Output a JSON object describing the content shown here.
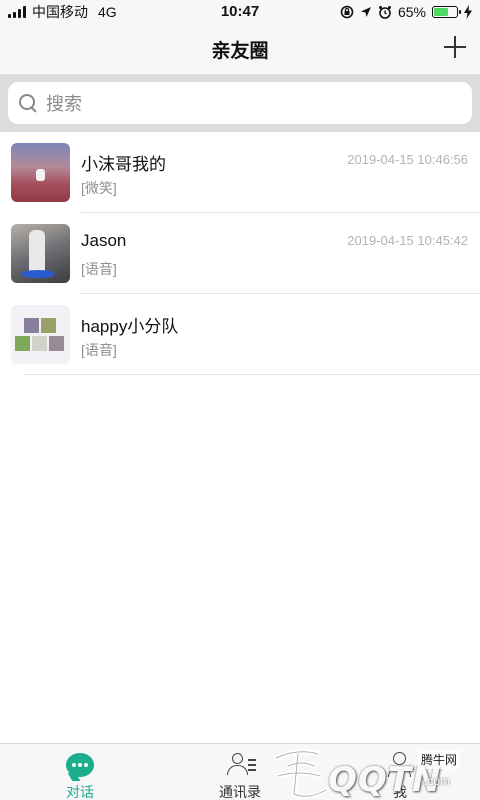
{
  "status_bar": {
    "carrier": "中国移动",
    "network": "4G",
    "time": "10:47",
    "battery_percent": "65%",
    "battery_level": 0.65,
    "icons": [
      "signal-icon",
      "lock-rotation-icon",
      "location-icon",
      "alarm-icon",
      "battery-icon",
      "charging-icon"
    ]
  },
  "nav": {
    "title": "亲友圈",
    "add_icon": "plus-icon"
  },
  "search": {
    "placeholder": "搜索",
    "icon": "search-icon"
  },
  "chats": [
    {
      "name": "小沫哥我的",
      "time": "2019-04-15 10:46:56",
      "message": "[微笑]"
    },
    {
      "name": "Jason",
      "time": "2019-04-15 10:45:42",
      "message": "[语音]"
    },
    {
      "name": "happy小分队",
      "time": "",
      "message": "[语音]"
    }
  ],
  "tabs": [
    {
      "label": "对话",
      "icon": "chat-bubble-icon",
      "active": true
    },
    {
      "label": "通讯录",
      "icon": "contacts-icon",
      "active": false
    },
    {
      "label": "我",
      "icon": "user-icon",
      "active": false
    }
  ],
  "colors": {
    "accent": "#1aad8e",
    "battery": "#4cd964",
    "header_bg": "#f7f7f7",
    "search_bg": "#dcdcdc"
  },
  "watermark": {
    "text": "QQTN",
    "suffix": ".com",
    "cn": "腾牛网"
  }
}
